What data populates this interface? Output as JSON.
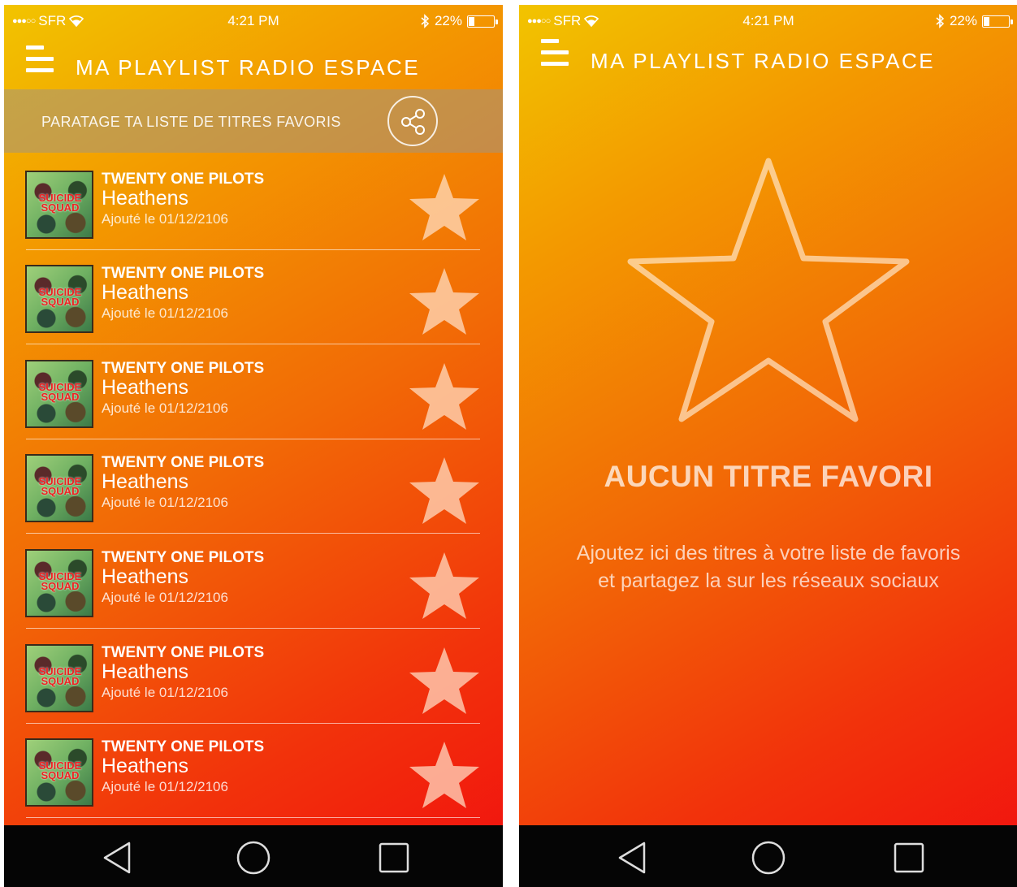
{
  "status_bar": {
    "carrier": "SFR",
    "time": "4:21 PM",
    "battery": "22%",
    "battery_level": 0.22,
    "signal_icon": "signal-dots-icon",
    "wifi_icon": "wifi-icon",
    "bluetooth_icon": "bluetooth-icon"
  },
  "header": {
    "title": "MA PLAYLIST RADIO ESPACE",
    "menu_icon": "menu-icon"
  },
  "share_bar": {
    "label": "PARATAGE TA LISTE DE TITRES FAVORIS",
    "icon": "share-icon"
  },
  "tracks": [
    {
      "artist": "TWENTY ONE PILOTS",
      "title": "Heathens",
      "added": "Ajouté le 01/12/2106"
    },
    {
      "artist": "TWENTY ONE PILOTS",
      "title": "Heathens",
      "added": "Ajouté le 01/12/2106"
    },
    {
      "artist": "TWENTY ONE PILOTS",
      "title": "Heathens",
      "added": "Ajouté le 01/12/2106"
    },
    {
      "artist": "TWENTY ONE PILOTS",
      "title": "Heathens",
      "added": "Ajouté le 01/12/2106"
    },
    {
      "artist": "TWENTY ONE PILOTS",
      "title": "Heathens",
      "added": "Ajouté le 01/12/2106"
    },
    {
      "artist": "TWENTY ONE PILOTS",
      "title": "Heathens",
      "added": "Ajouté le 01/12/2106"
    },
    {
      "artist": "TWENTY ONE PILOTS",
      "title": "Heathens",
      "added": "Ajouté le 01/12/2106"
    }
  ],
  "cover_art": {
    "line1": "SUICIDE",
    "line2": "SQUAD"
  },
  "empty_state": {
    "title": "AUCUN TITRE FAVORI",
    "text": "Ajoutez ici des titres à votre liste de favoris et partagez la sur les réseaux sociaux",
    "icon": "star-outline-icon"
  },
  "nav_bar": {
    "back_icon": "back-triangle-icon",
    "home_icon": "home-circle-icon",
    "recent_icon": "recent-square-icon"
  },
  "colors": {
    "gradient_start": "#f2c400",
    "gradient_end": "#f10f0f",
    "nav_background": "#050505"
  }
}
